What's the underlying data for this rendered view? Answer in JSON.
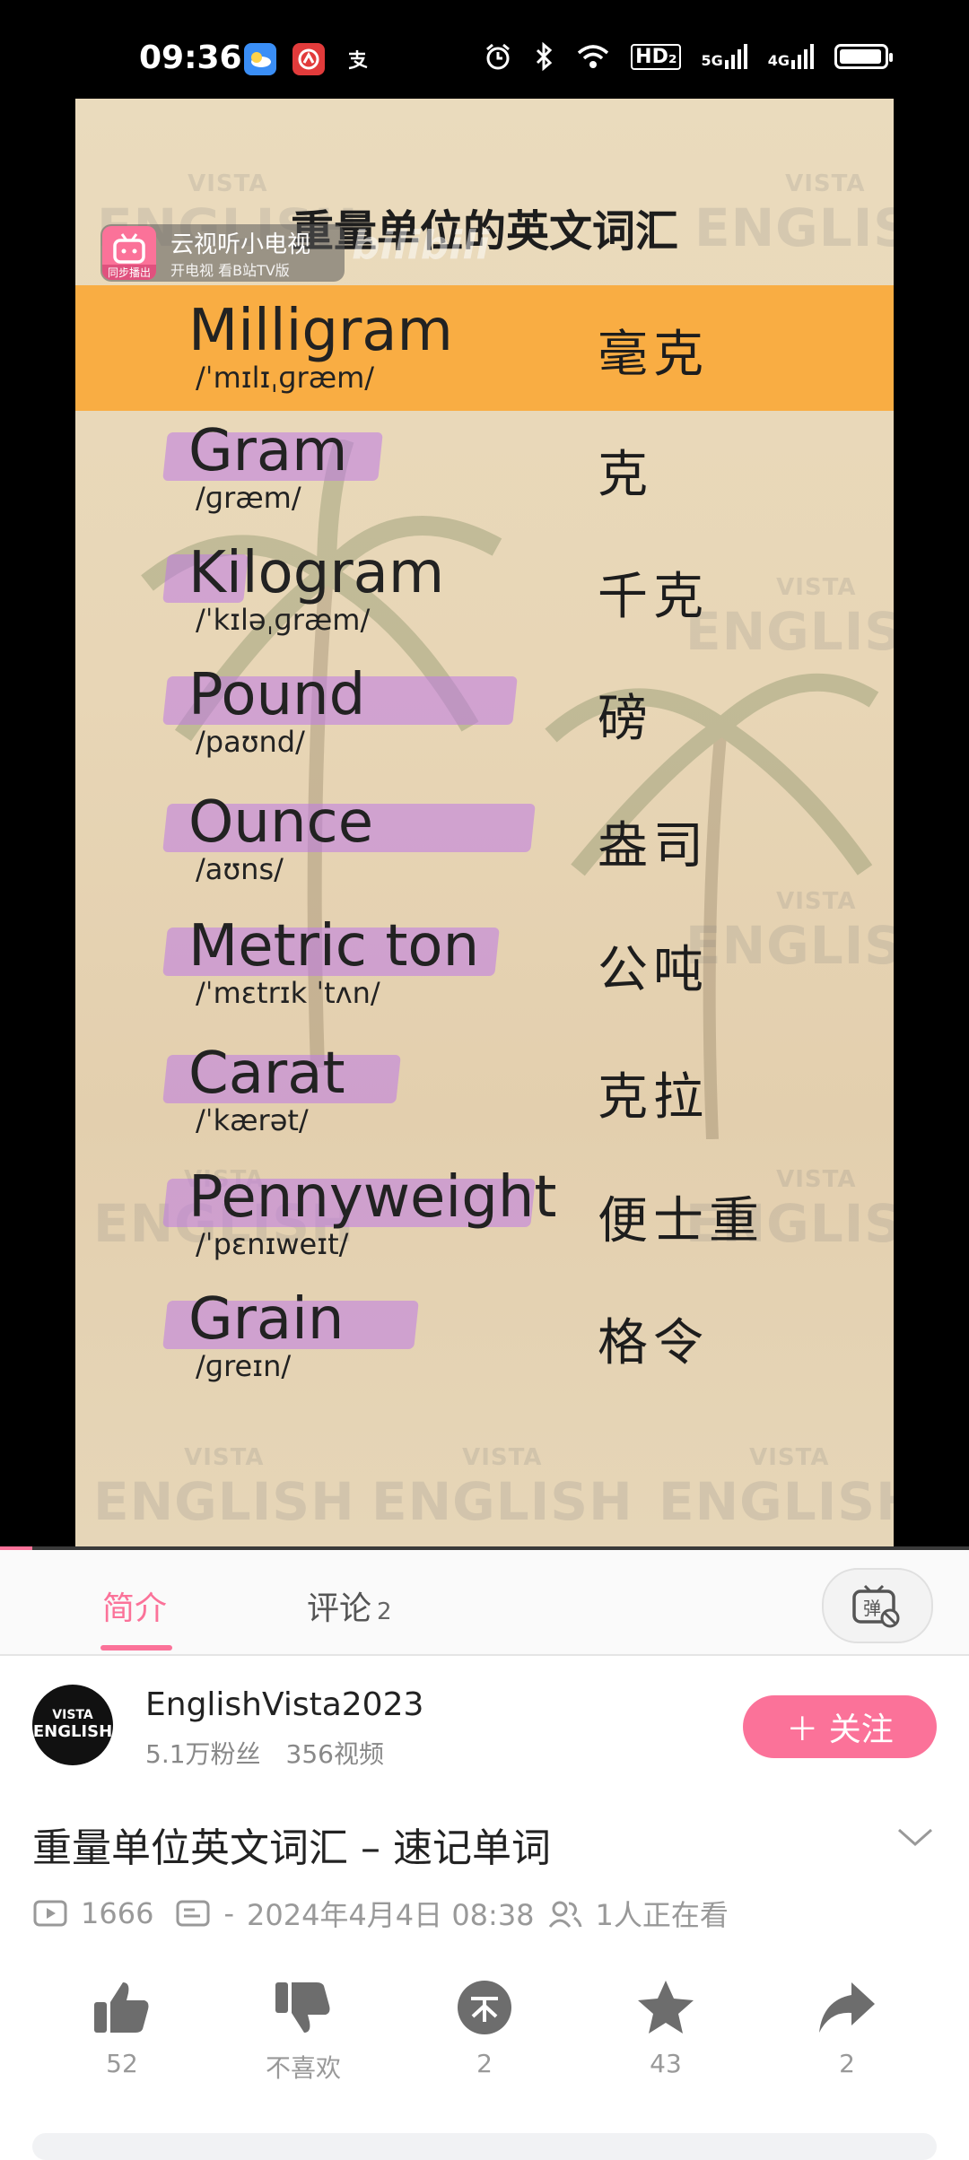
{
  "status_bar": {
    "time": "09:36",
    "icons": [
      "weather-icon",
      "app-red-icon",
      "alipay-icon",
      "alarm-icon",
      "bluetooth-icon",
      "wifi-icon",
      "hd-icon",
      "5g-signal-icon",
      "4g-signal-icon",
      "battery-icon"
    ],
    "labels": {
      "hd": "HD₂",
      "g5": "5G",
      "g4": "4G"
    }
  },
  "video": {
    "tv_badge": {
      "title": "云视听小电视",
      "subtitle": "开电视 看B站TV版",
      "tag": "同步播出"
    },
    "brand_text": "bilibili",
    "title": "重量单位的英文词汇",
    "watermark": {
      "top": "VISTA",
      "main": "ENGLISH"
    },
    "words": [
      {
        "en": "Milligram",
        "ipa": "/ˈmɪlɪˌɡræm/",
        "zh": "毫克"
      },
      {
        "en": "Gram",
        "ipa": "/ɡræm/",
        "zh": "克"
      },
      {
        "en": "Kilogram",
        "ipa": "/ˈkɪləˌɡræm/",
        "zh": "千克"
      },
      {
        "en": "Pound",
        "ipa": "/paʊnd/",
        "zh": "磅"
      },
      {
        "en": "Ounce",
        "ipa": "/aʊns/",
        "zh": "盎司"
      },
      {
        "en": "Metric ton",
        "ipa": "/ˈmɛtrɪk ˈtʌn/",
        "zh": "公吨"
      },
      {
        "en": "Carat",
        "ipa": "/ˈkærət/",
        "zh": "克拉"
      },
      {
        "en": "Pennyweight",
        "ipa": "/ˈpɛnɪweɪt/",
        "zh": "便士重"
      },
      {
        "en": "Grain",
        "ipa": "/ɡreɪn/",
        "zh": "格令"
      }
    ]
  },
  "tabs": {
    "intro": "简介",
    "comments": "评论",
    "comments_count": "2",
    "danmaku_icon": "danmaku-toggle-icon"
  },
  "uploader": {
    "avatar_top": "VISTA",
    "avatar_main": "ENGLISH",
    "name": "EnglishVista2023",
    "stats": "5.1万粉丝　356视频",
    "follow_label": "＋ 关注"
  },
  "video_info": {
    "title": "重量单位英文词汇 – 速记单词",
    "views": "1666",
    "danmaku": "-",
    "date": "2024年4月4日 08:38",
    "watching": "1人正在看"
  },
  "actions": [
    {
      "icon": "like-icon",
      "label": "52"
    },
    {
      "icon": "dislike-icon",
      "label": "不喜欢"
    },
    {
      "icon": "coin-icon",
      "label": "2"
    },
    {
      "icon": "favorite-icon",
      "label": "43"
    },
    {
      "icon": "share-icon",
      "label": "2"
    }
  ],
  "colors": {
    "accent": "#fb7299",
    "highlight": "#f9ad43",
    "word_mark": "#be78e6"
  }
}
